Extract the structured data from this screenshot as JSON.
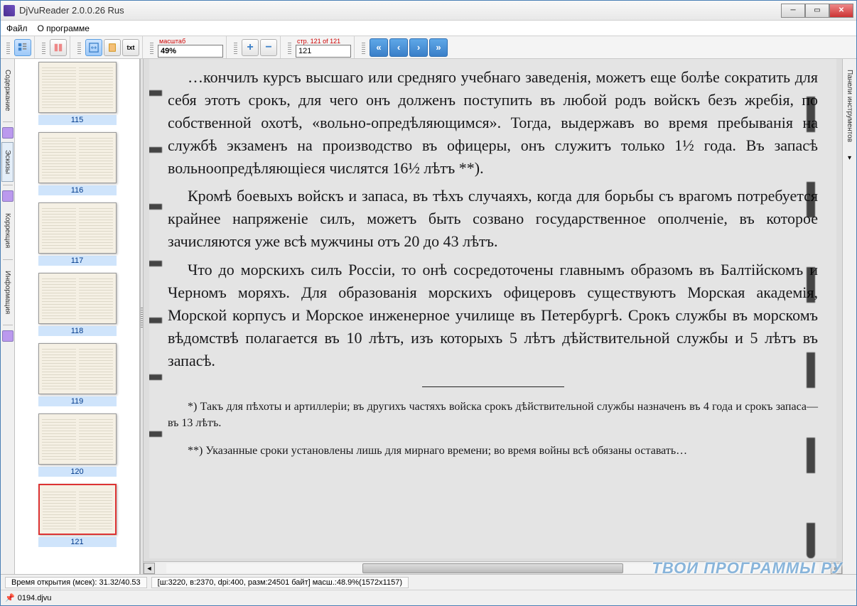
{
  "window": {
    "title": "DjVuReader 2.0.0.26 Rus"
  },
  "menu": {
    "file": "Файл",
    "about": "О программе"
  },
  "toolbar": {
    "scale_label": "масштаб",
    "scale_value": "49%",
    "page_label": "стр. 121 of 121",
    "page_value": "121"
  },
  "side_tabs": {
    "left": [
      "Содержание",
      "Эскизы",
      "Коррекция",
      "Информация"
    ],
    "right": "Панели инструментов"
  },
  "thumbnails": [
    {
      "num": "115"
    },
    {
      "num": "116"
    },
    {
      "num": "117"
    },
    {
      "num": "118"
    },
    {
      "num": "119"
    },
    {
      "num": "120"
    },
    {
      "num": "121",
      "selected": true
    }
  ],
  "document": {
    "p1": "…кончилъ курсъ высшаго или средняго учебнаго заведенія, можетъ еще болѣе сократить для себя этотъ срокъ, для чего онъ долженъ поступить въ любой родъ войскъ безъ жребія, по собственной охотѣ, «вольно-опредѣляющимся». Тогда, выдержавъ во время пребыванія на службѣ экзаменъ на производство въ офицеры, онъ служитъ только 1½ года. Въ запасѣ вольноопредѣляющіеся числятся 16½ лѣтъ **).",
    "p2": "Кромѣ боевыхъ войскъ и запаса, въ тѣхъ случаяхъ, когда для борьбы съ врагомъ потребуется крайнее напряженіе силъ, можетъ быть созвано государственное ополченіе, въ которое зачисляются уже всѣ мужчины отъ 20 до 43 лѣтъ.",
    "p3": "Что до морскихъ силъ Россіи, то онѣ сосредоточены главнымъ образомъ въ Балтійскомъ и Черномъ моряхъ. Для образованія морскихъ офицеровъ существуютъ Морская академія, Морской корпусъ и Морское инженерное училище въ Петербургѣ. Срокъ службы въ морскомъ вѣдомствѣ полагается въ 10 лѣтъ, изъ которыхъ 5 лѣтъ дѣйствительной службы и 5 лѣтъ въ запасѣ.",
    "fn1": "*) Такъ для пѣхоты и артиллеріи; въ другихъ частяхъ войска срокъ дѣйствительной службы назначенъ въ 4 года и срокъ запаса—въ 13 лѣтъ.",
    "fn2": "**) Указанные сроки установлены лишь для мирнаго времени; во время войны всѣ обязаны оставать…"
  },
  "status": {
    "open_time": "Время открытия (мсек): 31.32/40.53",
    "info": "[ш:3220, в:2370, dpi:400, разм:24501 байт] масш.:48.9%(1572x1157)"
  },
  "filebar": {
    "name": "0194.djvu"
  },
  "watermark": "ТВОИ ПРОГРАММЫ РУ"
}
